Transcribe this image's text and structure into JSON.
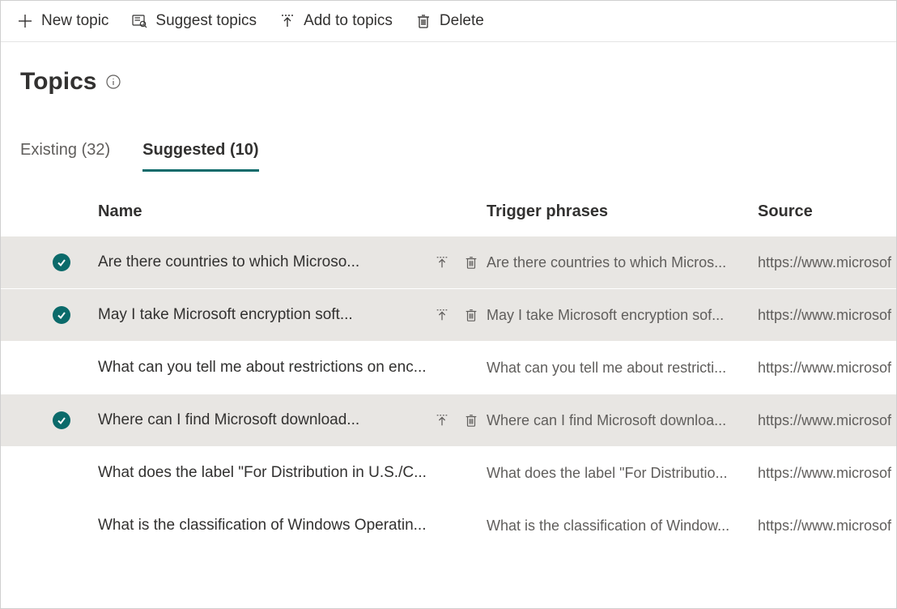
{
  "toolbar": {
    "new_topic": "New topic",
    "suggest_topics": "Suggest topics",
    "add_to_topics": "Add to topics",
    "delete": "Delete"
  },
  "page": {
    "title": "Topics"
  },
  "tabs": {
    "existing": {
      "label": "Existing (32)",
      "count": 32,
      "active": false
    },
    "suggested": {
      "label": "Suggested (10)",
      "count": 10,
      "active": true
    }
  },
  "columns": {
    "name": "Name",
    "trigger": "Trigger phrases",
    "source": "Source"
  },
  "rows": [
    {
      "selected": true,
      "name": "Are there countries to which Microso...",
      "trigger": "Are there countries to which Micros...",
      "source": "https://www.microsof"
    },
    {
      "selected": true,
      "name": "May I take Microsoft encryption soft...",
      "trigger": "May I take Microsoft encryption sof...",
      "source": "https://www.microsof"
    },
    {
      "selected": false,
      "name": "What can you tell me about restrictions on enc...",
      "trigger": "What can you tell me about restricti...",
      "source": "https://www.microsof"
    },
    {
      "selected": true,
      "name": "Where can I find Microsoft download...",
      "trigger": "Where can I find Microsoft downloa...",
      "source": "https://www.microsof"
    },
    {
      "selected": false,
      "name": "What does the label \"For Distribution in U.S./C...",
      "trigger": "What does the label \"For Distributio...",
      "source": "https://www.microsof"
    },
    {
      "selected": false,
      "name": "What is the classification of Windows Operatin...",
      "trigger": "What is the classification of Window...",
      "source": "https://www.microsof"
    }
  ]
}
